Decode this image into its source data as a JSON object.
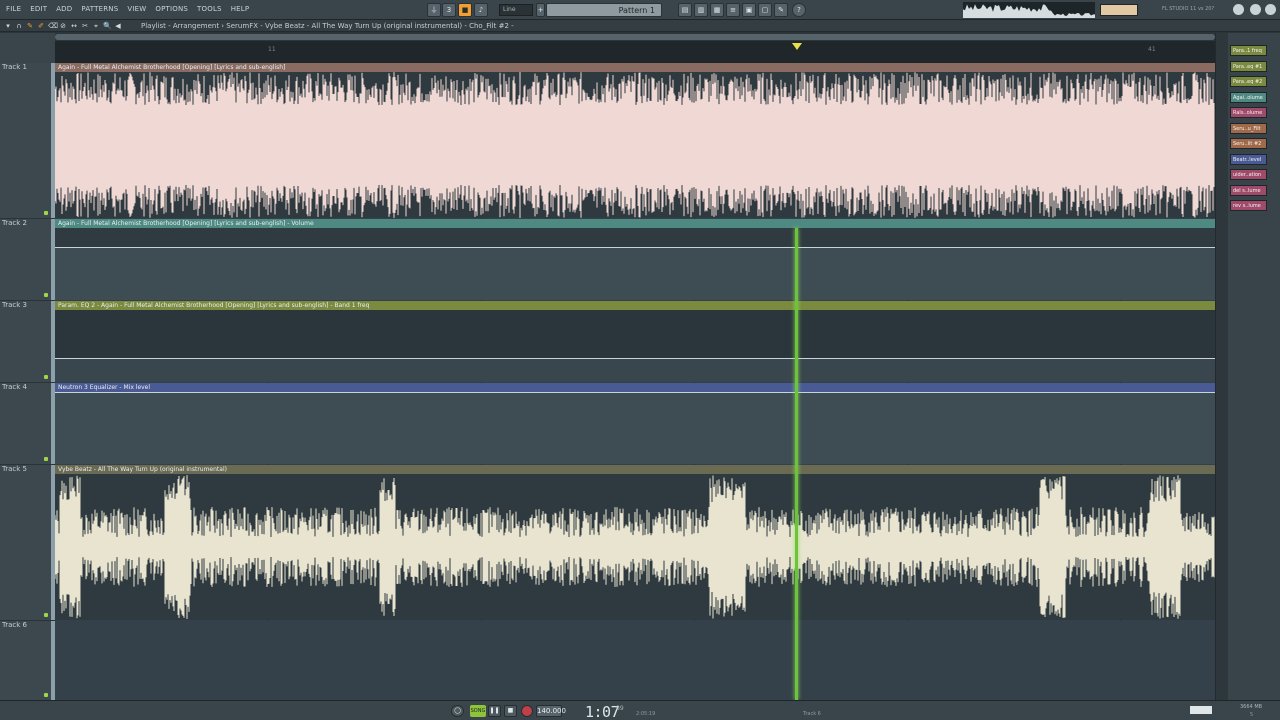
{
  "menu": {
    "items": [
      "FILE",
      "EDIT",
      "ADD",
      "PATTERNS",
      "VIEW",
      "OPTIONS",
      "TOOLS",
      "HELP"
    ]
  },
  "toolbar": {
    "snap_mode": "Line",
    "pattern_name": "Pattern 1",
    "song_mode_label": "SONG",
    "studio_label": "FL STUDIO 11 vs 20?"
  },
  "title_bar": {
    "title": "Playlist - Arrangement › SerumFX - Vybe Beatz - All The Way Turn Up (original instrumental) - Cho_Filt #2 -"
  },
  "ruler": {
    "numbers": [
      "11",
      "41"
    ]
  },
  "tracks": [
    {
      "label": "Track 1",
      "clip": "Again - Full Metal Alchemist Brotherhood [Opening] [Lyrics and sub-english]",
      "type": "audio",
      "header_color": "#8a6b62",
      "body_color": "#2e3a40",
      "wave_color": "#f0d8d4"
    },
    {
      "label": "Track 2",
      "clip": "Again - Full Metal Alchemist Brotherhood [Opening] [Lyrics and sub-english] - Volume",
      "type": "automation",
      "header_color": "#4e8a82",
      "body_color": "#3e4c54"
    },
    {
      "label": "Track 3",
      "clip": "Param. EQ 2 - Again - Full Metal Alchemist Brotherhood [Opening] [Lyrics and sub-english] - Band 1 freq",
      "type": "automation",
      "header_color": "#7a8a3e",
      "body_color": "#2f3b41"
    },
    {
      "label": "Track 4",
      "clip": "Neutron 3 Equalizer - Mix level",
      "type": "automation",
      "header_color": "#4a5a94",
      "body_color": "#3e4c54"
    },
    {
      "label": "Track 5",
      "clip": "Vybe Beatz - All The Way Turn Up (original instrumental)",
      "type": "audio",
      "header_color": "#6b6a52",
      "body_color": "#2e3a40",
      "wave_color": "#e8e4d0"
    },
    {
      "label": "Track 6",
      "clip": "",
      "type": "empty",
      "header_color": "",
      "body_color": "#34404a"
    }
  ],
  "picker": {
    "items": [
      {
        "label": "Para..1 freq",
        "color": "#7a8a3e"
      },
      {
        "label": "Para..eq #1",
        "color": "#7a8a3e"
      },
      {
        "label": "Para..eq #2",
        "color": "#7a8a3e"
      },
      {
        "label": "Agai..olume",
        "color": "#4e8a82"
      },
      {
        "label": "Rals..olume",
        "color": "#a04a6a"
      },
      {
        "label": "Seru..u_Filt",
        "color": "#a06a4a"
      },
      {
        "label": "Seru..lit #2",
        "color": "#a06a4a"
      },
      {
        "label": "Beatr..level",
        "color": "#4a5a94"
      },
      {
        "label": "uider..ation",
        "color": "#a04a6a"
      },
      {
        "label": "del s..lume",
        "color": "#a04a6a"
      },
      {
        "label": "rev s..lume",
        "color": "#a04a6a"
      }
    ]
  },
  "transport": {
    "pat_song": "SONG",
    "tempo": "140.000",
    "time_main": "1:07",
    "time_sub": "89",
    "time_small": "2:05:19",
    "track_readout": "Track 6",
    "memory": "3664 MB",
    "mem_sub": "5"
  },
  "colors": {
    "playhead": "#6cc43a",
    "accent": "#f0a032"
  }
}
